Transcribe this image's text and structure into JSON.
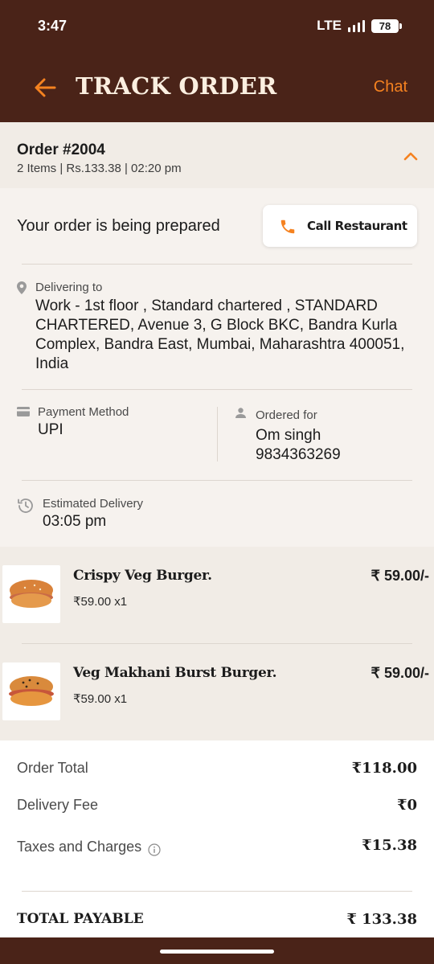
{
  "status_bar": {
    "time": "3:47",
    "network": "LTE",
    "battery": "78"
  },
  "header": {
    "title": "TRACK ORDER",
    "chat_label": "Chat"
  },
  "order": {
    "number": "Order #2004",
    "summary": "2 Items | Rs.133.38 | 02:20 pm"
  },
  "status": {
    "message": "Your order is being prepared",
    "call_label": "Call Restaurant"
  },
  "delivery": {
    "label": "Delivering to",
    "address_lines": [
      "Work - 1st floor , Standard chartered ,  STANDARD",
      "CHARTERED, Avenue 3, G Block BKC, Bandra Kurla",
      "Complex, Bandra East, Mumbai, Maharashtra 400051,",
      "India"
    ]
  },
  "payment": {
    "label": "Payment Method",
    "value": "UPI"
  },
  "ordered_for": {
    "label": "Ordered for",
    "name": "Om singh",
    "phone": "9834363269"
  },
  "estimated": {
    "label": "Estimated Delivery",
    "time": "03:05 pm"
  },
  "items": [
    {
      "name": "Crispy Veg Burger.",
      "qty": "₹59.00 x1",
      "price": "₹ 59.00/-"
    },
    {
      "name": "Veg Makhani Burst Burger.",
      "qty": "₹59.00 x1",
      "price": "₹ 59.00/-"
    }
  ],
  "totals": {
    "order_total_label": "Order Total",
    "order_total": "₹118.00",
    "delivery_fee_label": "Delivery Fee",
    "delivery_fee": "₹0",
    "taxes_label": "Taxes and Charges",
    "taxes": "₹15.38",
    "payable_label": "TOTAL PAYABLE",
    "payable": "₹ 133.38"
  },
  "colors": {
    "header_bg": "#4a2318",
    "accent": "#f58220",
    "title_text": "#fbefe0"
  }
}
